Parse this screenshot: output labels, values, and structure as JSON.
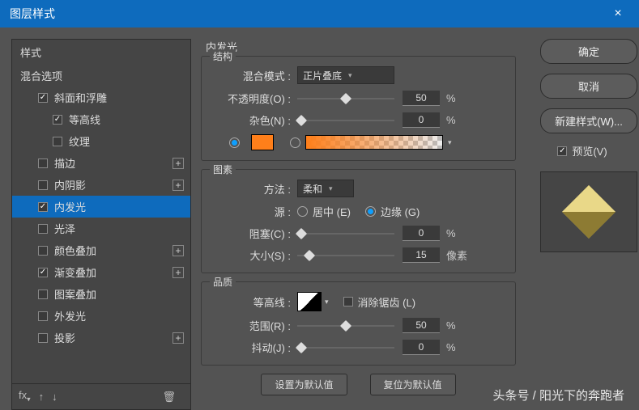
{
  "title": "图层样式",
  "sidebar": {
    "styles_label": "样式",
    "blend_options_label": "混合选项",
    "items": [
      {
        "label": "斜面和浮雕",
        "checked": true,
        "level": 2,
        "add": false
      },
      {
        "label": "等高线",
        "checked": true,
        "level": 3,
        "add": false
      },
      {
        "label": "纹理",
        "checked": false,
        "level": 3,
        "add": false
      },
      {
        "label": "描边",
        "checked": false,
        "level": 2,
        "add": true
      },
      {
        "label": "内阴影",
        "checked": false,
        "level": 2,
        "add": true
      },
      {
        "label": "内发光",
        "checked": true,
        "level": 2,
        "add": false,
        "selected": true
      },
      {
        "label": "光泽",
        "checked": false,
        "level": 2,
        "add": false
      },
      {
        "label": "颜色叠加",
        "checked": false,
        "level": 2,
        "add": true
      },
      {
        "label": "渐变叠加",
        "checked": true,
        "level": 2,
        "add": true
      },
      {
        "label": "图案叠加",
        "checked": false,
        "level": 2,
        "add": false
      },
      {
        "label": "外发光",
        "checked": false,
        "level": 2,
        "add": false
      },
      {
        "label": "投影",
        "checked": false,
        "level": 2,
        "add": true
      }
    ]
  },
  "panel": {
    "title": "内发光",
    "structure": {
      "legend": "结构",
      "blend_mode_label": "混合模式 :",
      "blend_mode_value": "正片叠底",
      "opacity_label": "不透明度(O) :",
      "opacity_value": "50",
      "opacity_unit": "%",
      "noise_label": "杂色(N) :",
      "noise_value": "0",
      "noise_unit": "%",
      "color_hex": "#ff7f1a"
    },
    "elements": {
      "legend": "图素",
      "technique_label": "方法 :",
      "technique_value": "柔和",
      "source_label": "源 :",
      "source_center": "居中 (E)",
      "source_edge": "边缘 (G)",
      "choke_label": "阻塞(C) :",
      "choke_value": "0",
      "choke_unit": "%",
      "size_label": "大小(S) :",
      "size_value": "15",
      "size_unit": "像素"
    },
    "quality": {
      "legend": "品质",
      "contour_label": "等高线 :",
      "antialias_label": "消除锯齿 (L)",
      "range_label": "范围(R) :",
      "range_value": "50",
      "range_unit": "%",
      "jitter_label": "抖动(J) :",
      "jitter_value": "0",
      "jitter_unit": "%"
    },
    "make_default": "设置为默认值",
    "reset_default": "复位为默认值"
  },
  "right": {
    "ok": "确定",
    "cancel": "取消",
    "new_style": "新建样式(W)...",
    "preview": "预览(V)"
  },
  "watermark": "头条号 / 阳光下的奔跑者"
}
